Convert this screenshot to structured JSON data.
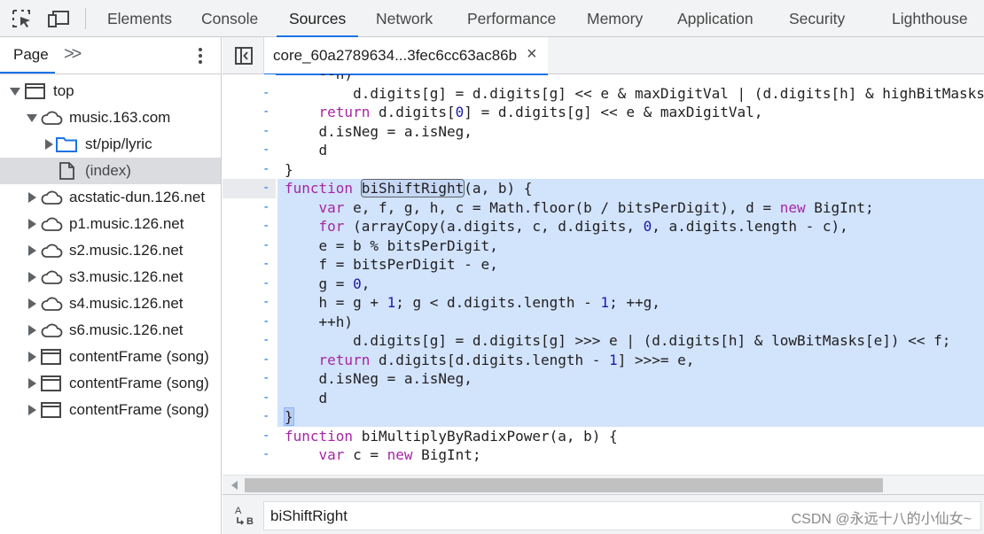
{
  "toolbar": {
    "inspect_icon": "inspect-element-icon",
    "device_icon": "device-toolbar-icon",
    "tabs": [
      "Elements",
      "Console",
      "Sources",
      "Network",
      "Performance",
      "Memory",
      "Application",
      "Security",
      "Lighthouse"
    ],
    "active_tab": "Sources"
  },
  "navigator": {
    "tab_label": "Page",
    "more_label": ">>",
    "tree": [
      {
        "label": "top",
        "icon": "frame-icon",
        "expanded": true
      },
      {
        "label": "music.163.com",
        "icon": "cloud-icon",
        "expanded": true
      },
      {
        "label": "st/pip/lyric",
        "icon": "folder-icon",
        "expanded": false
      },
      {
        "label": "(index)",
        "icon": "file-icon",
        "selected": true
      },
      {
        "label": "acstatic-dun.126.net",
        "icon": "cloud-icon",
        "expanded": false
      },
      {
        "label": "p1.music.126.net",
        "icon": "cloud-icon",
        "expanded": false
      },
      {
        "label": "s2.music.126.net",
        "icon": "cloud-icon",
        "expanded": false
      },
      {
        "label": "s3.music.126.net",
        "icon": "cloud-icon",
        "expanded": false
      },
      {
        "label": "s4.music.126.net",
        "icon": "cloud-icon",
        "expanded": false
      },
      {
        "label": "s6.music.126.net",
        "icon": "cloud-icon",
        "expanded": false
      },
      {
        "label": "contentFrame (song)",
        "icon": "frame-icon",
        "expanded": false
      },
      {
        "label": "contentFrame (song)",
        "icon": "frame-icon",
        "expanded": false
      },
      {
        "label": "contentFrame (song)",
        "icon": "frame-icon",
        "expanded": false
      }
    ]
  },
  "editor": {
    "file_tab": "core_60a2789634...3fec6cc63ac86b",
    "close_symbol": "×",
    "gutter_mark": "-",
    "lines": [
      "    --h)",
      "        d.digits[g] = d.digits[g] << e & maxDigitVal | (d.digits[h] & highBitMasks",
      "    return d.digits[0] = d.digits[g] << e & maxDigitVal,",
      "    d.isNeg = a.isNeg,",
      "    d",
      "}",
      "function biShiftRight(a, b) {",
      "    var e, f, g, h, c = Math.floor(b / bitsPerDigit), d = new BigInt;",
      "    for (arrayCopy(a.digits, c, d.digits, 0, a.digits.length - c),",
      "    e = b % bitsPerDigit,",
      "    f = bitsPerDigit - e,",
      "    g = 0,",
      "    h = g + 1; g < d.digits.length - 1; ++g,",
      "    ++h)",
      "        d.digits[g] = d.digits[g] >>> e | (d.digits[h] & lowBitMasks[e]) << f;",
      "    return d.digits[d.digits.length - 1] >>>= e,",
      "    d.isNeg = a.isNeg,",
      "    d",
      "}",
      "function biMultiplyByRadixPower(a, b) {",
      "    var c = new BigInt;"
    ],
    "highlight_from": 6,
    "highlight_to": 18,
    "search_match": "biShiftRight"
  },
  "search": {
    "icon": "match-case-icon",
    "value": "biShiftRight"
  },
  "watermark": "CSDN @永远十八的小仙女~",
  "colors": {
    "accent": "#1a73e8",
    "highlight": "#d2e3fc",
    "keyword": "#a626a4",
    "number": "#1a1aa6"
  }
}
